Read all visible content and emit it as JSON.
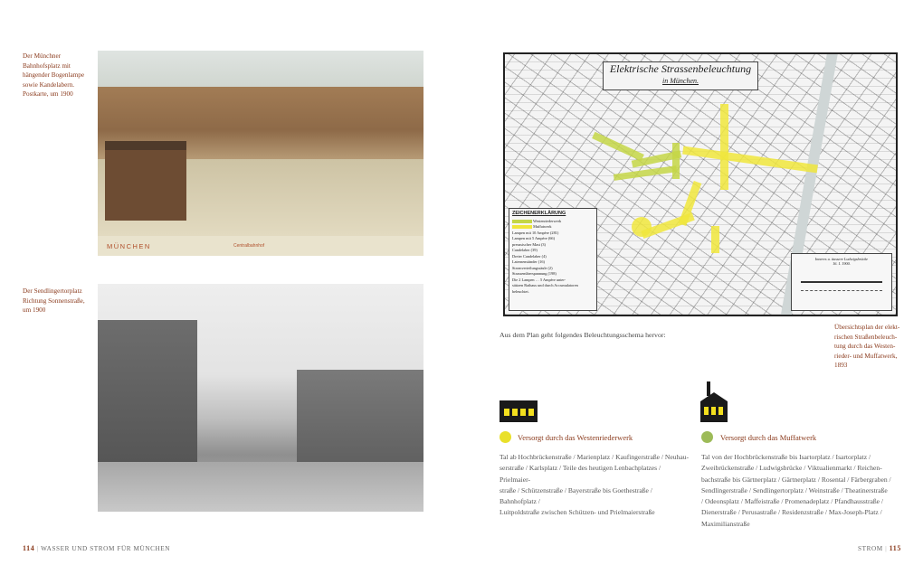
{
  "left_page": {
    "caption_top": [
      "Der Münchner",
      "Bahnhofsplatz mit",
      "hängender Bogenlampe",
      "sowie Kandelabern.",
      "Postkarte, um 1900"
    ],
    "postcard_city": "MÜNCHEN",
    "postcard_sub": "Centralbahnhof",
    "caption_bottom": [
      "Der Sendlingertorplatz",
      "Richtung Sonnenstraße,",
      "um 1900"
    ],
    "page_number": "114",
    "running_head": "WASSER UND STROM FÜR MÜNCHEN"
  },
  "right_page": {
    "map": {
      "title": "Elektrische Strassenbeleuchtung",
      "subtitle": "in München.",
      "legend_title": "ZEICHENERKLÄRUNG",
      "legend_rows": [
        "Westenriederwerk",
        "Muffatwerk",
        "Lampen mit 10 Ampère (281)",
        "Lampen mit 5 Ampère (66)",
        "preussischer Mast (3)",
        "Candelaber (39)",
        "Dreier Candelaber (4)",
        "Laternenständer (16)",
        "Stromverteilungssäule (2)",
        "Strassenüberspannung (198)",
        "Die 2 Lampen … 5 Ampère unter-",
        "stützen Rathaus und durch Accumulatoren",
        "beleuchtet."
      ],
      "inset_title": "Inneres u. äussere Ludwigsbrücke",
      "inset_date": "16. I. 1900."
    },
    "map_caption": [
      "Übersichtsplan der elekt-",
      "rischen Straßenbeleuch-",
      "tung durch das Westen-",
      "rieder- und Muffatwerk,",
      "1893"
    ],
    "plan_intro": "Aus dem Plan geht folgendes Beleuchtungsschema hervor:",
    "west": {
      "title": "Versorgt durch das Westenriederwerk",
      "dot_color": "#e9e02a",
      "text": [
        "Tal ab Hochbrückenstraße / Marienplatz / Kaufingerstraße / Neuhau-",
        "serstraße / Karlsplatz / Teile des heutigen Lenbachplatzes / Prielmaier-",
        "straße / Schützenstraße / Bayerstraße bis Goethestraße / Bahnhofplatz /",
        "Luitpoldstraße zwischen Schützen- und Prielmaierstraße"
      ]
    },
    "muffat": {
      "title": "Versorgt durch das Muffatwerk",
      "dot_color": "#9dbb58",
      "text": [
        "Tal von der Hochbrückenstraße bis Isartorplatz / Isartorplatz /",
        "Zweibrückenstraße / Ludwigsbrücke / Viktualienmarkt / Reichen-",
        "bachstraße bis Gärtnerplatz / Gärtnerplatz / Rosental / Färbergraben /",
        "Sendlingerstraße / Sendlingertorplatz / Weinstraße / Theatinerstraße",
        "/ Odeonsplatz / Maffeistraße / Promenadeplatz / Pfandhausstraße /",
        "Dienerstraße / Perusastraße / Residenzstraße / Max-Joseph-Platz /",
        "Maximilianstraße"
      ]
    },
    "running_head": "STROM",
    "page_number": "115"
  },
  "colors": {
    "accent": "#8a3a1c",
    "factory_icon": "#1a1a1a",
    "factory_yellow": "#f3df1e"
  }
}
